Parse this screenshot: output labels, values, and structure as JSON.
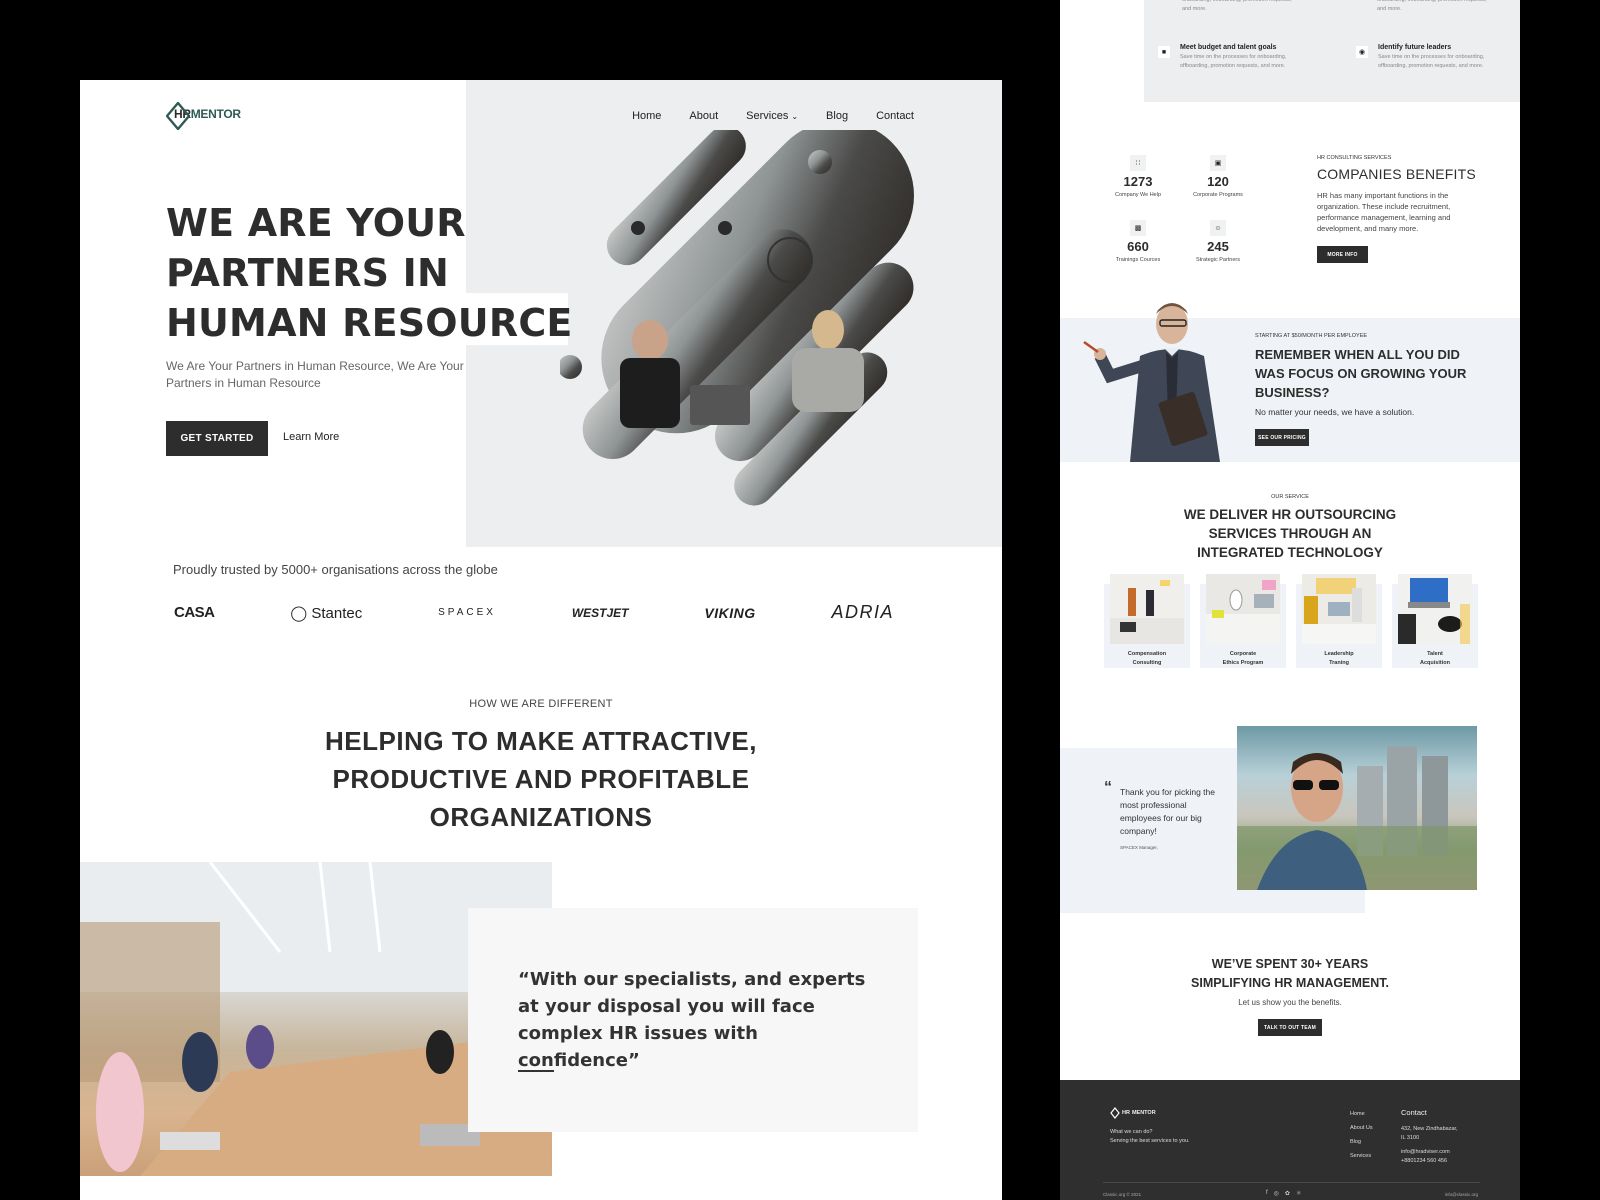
{
  "brand": {
    "name_hr": "HR",
    "name_rest": "MENTOR",
    "accent": "#2f5b55",
    "dark": "#2d2d2d"
  },
  "nav": {
    "items": [
      "Home",
      "About",
      "Services",
      "Blog",
      "Contact"
    ],
    "services_chevron": "chevron-down-icon"
  },
  "hero": {
    "title_line1": "WE ARE YOUR",
    "title_line2": "PARTNERS IN",
    "title_line3": "HUMAN RESOURCE",
    "subtitle": "We Are Your Partners in Human Resource, We Are Your Partners in Human Resource",
    "cta_primary": "GET STARTED",
    "cta_secondary": "Learn More"
  },
  "trusted": {
    "text": "Proudly trusted by 5000+ organisations across the globe",
    "logos": [
      "CASA",
      "Stantec",
      "SPACEX",
      "WESTJET",
      "VIKING",
      "ADRIA"
    ]
  },
  "different": {
    "eyebrow": "HOW WE ARE DIFFERENT",
    "title_line1": "HELPING TO MAKE ATTRACTIVE,",
    "title_line2": "PRODUCTIVE AND PROFITABLE",
    "title_line3": "ORGANIZATIONS",
    "quote": "“With our specialists, and experts at your disposal you will face complex HR issues with confidence”"
  },
  "features": {
    "top_desc": "onboarding, offboarding, promotion requests, and more.",
    "items": [
      {
        "title": "Meet budget and talent goals",
        "desc": "Save time on the processes for onboarding, offboarding, promotion requests, and more.",
        "icon": "calculator-icon"
      },
      {
        "title": "Identify future leaders",
        "desc": "Save time on the processes for onboarding, offboarding, promotion requests, and more.",
        "icon": "eye-icon"
      }
    ]
  },
  "stats": [
    {
      "value": "1273",
      "label": "Company We Help",
      "icon": "grid-icon"
    },
    {
      "value": "120",
      "label": "Corporate Programs",
      "icon": "briefcase-icon"
    },
    {
      "value": "660",
      "label": "Trainings Cources",
      "icon": "box-icon"
    },
    {
      "value": "245",
      "label": "Strategic Partners",
      "icon": "users-icon"
    }
  ],
  "benefits": {
    "eyebrow": "HR CONSULTING SERVICES",
    "title": "COMPANIES BENEFITS",
    "desc": "HR has many important functions in the organization. These include recruitment, performance management, learning and development, and many more.",
    "button": "MORE INFO"
  },
  "pricing": {
    "eyebrow": "STARTING AT $50/MONTH PER EMPLOYEE",
    "title": "REMEMBER WHEN ALL YOU DID WAS FOCUS ON GROWING YOUR BUSINESS?",
    "subtitle": "No matter your needs, we have a solution.",
    "button": "SEE OUR PRICING"
  },
  "services": {
    "eyebrow": "OUR SERVICE",
    "title_line1": "WE DELIVER HR OUTSOURCING",
    "title_line2": "SERVICES THROUGH AN",
    "title_line3": "INTEGRATED TECHNOLOGY",
    "cards": [
      {
        "line1": "Compensation",
        "line2": "Consulting"
      },
      {
        "line1": "Corporate",
        "line2": "Ethics Program"
      },
      {
        "line1": "Leadership",
        "line2": "Traning"
      },
      {
        "line1": "Talent",
        "line2": "Acquisition"
      }
    ]
  },
  "testimonial": {
    "quote_mark": "“",
    "text": "Thank you for picking the most professional employees for our big company!",
    "author": "SPACEX Manager,"
  },
  "years": {
    "title_line1": "WE’VE SPENT 30+ YEARS",
    "title_line2": "SIMPLIFYING HR MANAGEMENT.",
    "subtitle": "Let us show you the benefits.",
    "button": "TALK TO OUT TEAM"
  },
  "footer": {
    "what_line1": "What we can do?",
    "what_line2": "Serving the best services to you.",
    "links": [
      "Home",
      "About Us",
      "Blog",
      "Services"
    ],
    "contact_title": "Contact",
    "address_line1": "432, New Zindhabazar,",
    "address_line2": "IL 3100",
    "email": "info@hradviser.com",
    "phone": "+8801234 560 456",
    "copyright": "Classic.org © 2021",
    "social": [
      "facebook-icon",
      "instagram-icon",
      "twitter-icon",
      "dribbble-icon"
    ],
    "email_right": "info@classic.org"
  }
}
